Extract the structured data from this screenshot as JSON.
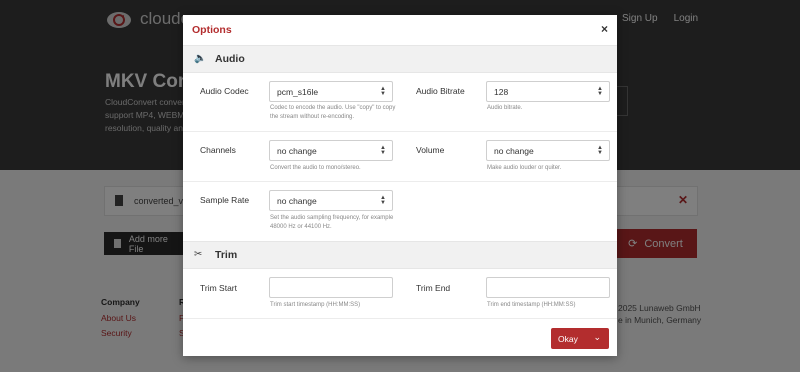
{
  "background": {
    "logo_text": "cloudc",
    "nav": [
      "Sign Up",
      "Login"
    ],
    "hero_title": "MKV Conv",
    "hero_lines": [
      "CloudConvert conver",
      "support MP4, WEBM",
      "resolution, quality an"
    ],
    "file_name": "converted_vi",
    "add_files_label": "Add more File",
    "convert_label": "Convert",
    "footer": {
      "company_heading": "Company",
      "company_links": [
        "About Us",
        "Security"
      ],
      "col2_heading": "R",
      "col2_links": [
        "F",
        "S"
      ],
      "copyright": "2025 Lunaweb GmbH",
      "made_in": "e in Munich, Germany"
    }
  },
  "modal": {
    "title": "Options",
    "close_glyph": "×",
    "audio_section": "Audio",
    "trim_section": "Trim",
    "audio_codec": {
      "label": "Audio Codec",
      "value": "pcm_s16le",
      "hint": "Codec to encode the audio. Use \"copy\" to copy the stream without re-encoding."
    },
    "audio_bitrate": {
      "label": "Audio Bitrate",
      "value": "128",
      "hint": "Audio bitrate."
    },
    "channels": {
      "label": "Channels",
      "value": "no change",
      "hint": "Convert the audio to mono/stereo."
    },
    "volume": {
      "label": "Volume",
      "value": "no change",
      "hint": "Make audio louder or quiter."
    },
    "sample_rate": {
      "label": "Sample Rate",
      "value": "no change",
      "hint": "Set the audio sampling frequency, for example 48000 Hz or 44100 Hz."
    },
    "trim_start": {
      "label": "Trim Start",
      "value": "",
      "hint": "Trim start timestamp (HH:MM:SS)"
    },
    "trim_end": {
      "label": "Trim End",
      "value": "",
      "hint": "Trim end timestamp (HH:MM:SS)"
    },
    "okay_label": "Okay"
  },
  "colors": {
    "accent": "#b32d2e",
    "header_bg": "#3b3b3b"
  },
  "icons": [
    "cloud-logo-icon",
    "file-icon",
    "close-icon",
    "upload-file-icon",
    "refresh-icon",
    "speaker-icon",
    "scissors-icon",
    "chevron-down-icon",
    "select-caret-icon",
    "stepper-icon"
  ]
}
